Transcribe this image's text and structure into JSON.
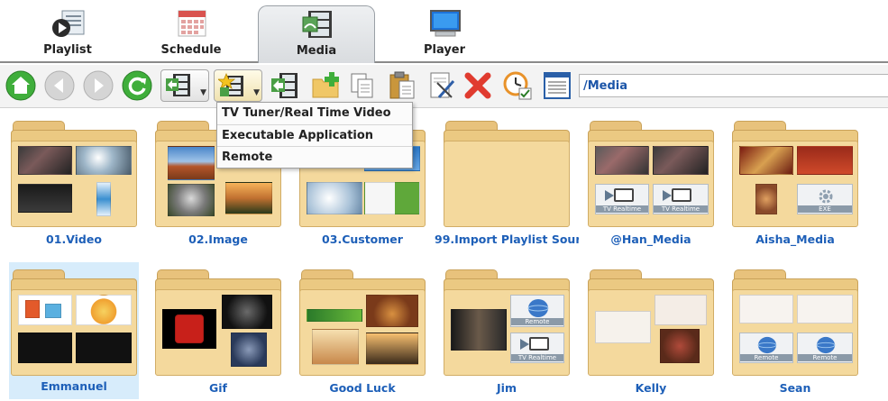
{
  "tabs": [
    {
      "label": "Playlist",
      "icon": "playlist-icon"
    },
    {
      "label": "Schedule",
      "icon": "calendar-icon"
    },
    {
      "label": "Media",
      "icon": "film-icon",
      "active": true
    },
    {
      "label": "Player",
      "icon": "monitor-icon"
    }
  ],
  "toolbar": {
    "buttons": [
      "home-icon",
      "back-icon",
      "forward-icon",
      "refresh-icon",
      "add-media-icon",
      "add-special-media-icon",
      "import-media-icon",
      "new-folder-icon",
      "copy-icon",
      "paste-icon",
      "edit-icon",
      "delete-icon",
      "schedule-check-icon",
      "details-view-icon"
    ],
    "path": "/Media"
  },
  "dropdown": {
    "items": [
      "TV Tuner/Real Time Video",
      "Executable Application",
      "Remote"
    ]
  },
  "folders": [
    {
      "name": "01.Video"
    },
    {
      "name": "02.Image"
    },
    {
      "name": "03.Customer"
    },
    {
      "name": "99.Import Playlist Sour"
    },
    {
      "name": "@Han_Media"
    },
    {
      "name": "Aisha_Media"
    },
    {
      "name": "Emmanuel",
      "selected": true
    },
    {
      "name": "Gif"
    },
    {
      "name": "Good Luck"
    },
    {
      "name": "Jim"
    },
    {
      "name": "Kelly"
    },
    {
      "name": "Sean"
    }
  ],
  "thumb_labels": {
    "tv": "TV Realtime",
    "exe": "EXE",
    "remote": "Remote"
  },
  "colors": {
    "accent": "#1d5fb8",
    "folder": "#f4d99d",
    "selected": "#d7ecfb"
  }
}
